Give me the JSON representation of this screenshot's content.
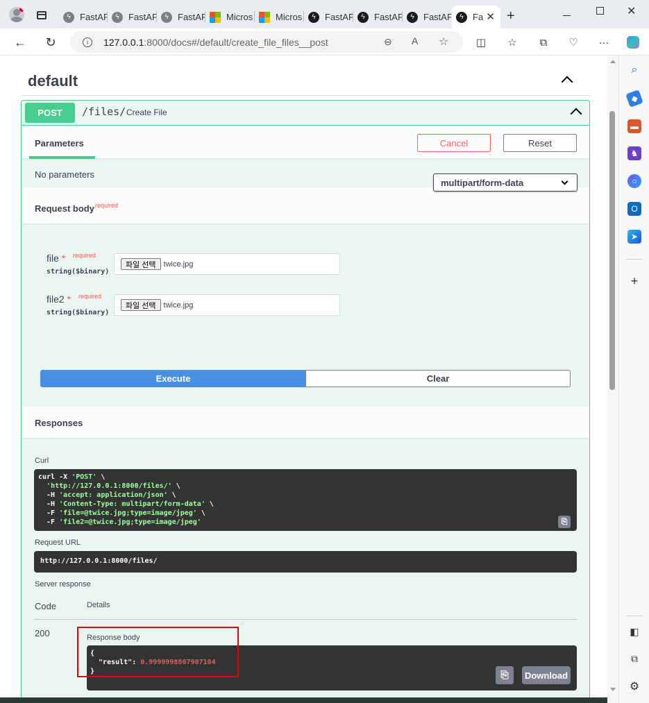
{
  "browser": {
    "tabs": [
      {
        "label": "FastAP",
        "icon": "fastapi-gray"
      },
      {
        "label": "FastAP",
        "icon": "fastapi-gray"
      },
      {
        "label": "FastAP",
        "icon": "fastapi-gray"
      },
      {
        "label": "Micros",
        "icon": "microsoft-logo"
      },
      {
        "label": "Micros",
        "icon": "microsoft-logo"
      },
      {
        "label": "FastAP",
        "icon": "fastapi-dark"
      },
      {
        "label": "FastAP",
        "icon": "fastapi-dark"
      },
      {
        "label": "FastAP",
        "icon": "fastapi-dark"
      },
      {
        "label": "Fa",
        "icon": "fastapi-dark",
        "active": true
      }
    ],
    "url_host": "127.0.0.1",
    "url_rest": ":8000/docs#/default/create_file_files__post"
  },
  "section": {
    "title": "default"
  },
  "operation": {
    "method": "POST",
    "path": "/files/",
    "summary": "Create File",
    "accent_color": "#49cc90"
  },
  "params": {
    "tab_label": "Parameters",
    "cancel_label": "Cancel",
    "reset_label": "Reset",
    "empty_text": "No parameters"
  },
  "request_body": {
    "label": "Request body",
    "required_label": "required",
    "content_type": "multipart/form-data",
    "fields": [
      {
        "name": "file",
        "star": "*",
        "required": "required",
        "type": "string($binary)",
        "button": "파일 선택",
        "filename": "twice.jpg"
      },
      {
        "name": "file2",
        "star": "*",
        "required": "required",
        "type": "string($binary)",
        "button": "파일 선택",
        "filename": "twice.jpg"
      }
    ]
  },
  "actions": {
    "execute_label": "Execute",
    "clear_label": "Clear",
    "execute_color": "#4990e2"
  },
  "responses": {
    "title": "Responses",
    "curl_label": "Curl",
    "curl_lines": [
      {
        "pre": "curl -X ",
        "str": "'POST'",
        "post": " \\"
      },
      {
        "pre": "  ",
        "str": "'http://127.0.0.1:8000/files/'",
        "post": " \\"
      },
      {
        "pre": "  -H ",
        "str": "'accept: application/json'",
        "post": " \\"
      },
      {
        "pre": "  -H ",
        "str": "'Content-Type: multipart/form-data'",
        "post": " \\"
      },
      {
        "pre": "  -F ",
        "str": "'file=@twice.jpg;type=image/jpeg'",
        "post": " \\"
      },
      {
        "pre": "  -F ",
        "str": "'file2=@twice.jpg;type=image/jpeg'",
        "post": ""
      }
    ],
    "request_url_label": "Request URL",
    "request_url": "http://127.0.0.1:8000/files/",
    "server_response_label": "Server response",
    "code_header": "Code",
    "details_header": "Details",
    "code": "200",
    "response_body_label": "Response body",
    "body_open": "{",
    "body_key": "  \"result\": ",
    "body_value": "0.9999998807907104",
    "body_close": "}",
    "download_label": "Download"
  }
}
